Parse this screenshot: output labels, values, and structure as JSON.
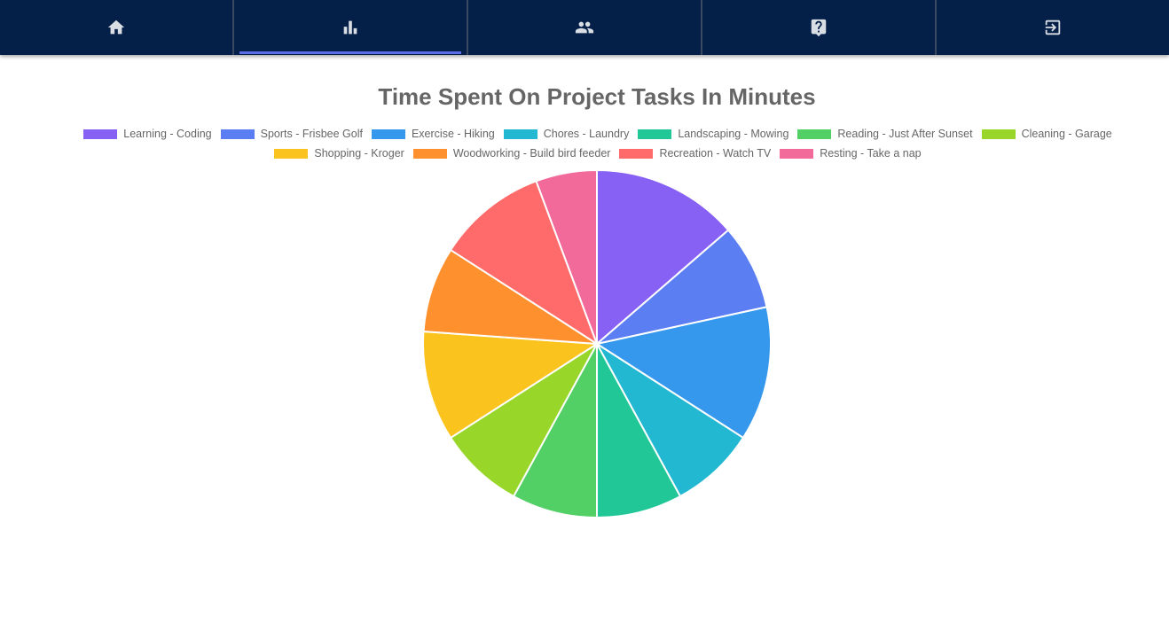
{
  "nav": {
    "items": [
      {
        "icon": "home-icon",
        "active": false
      },
      {
        "icon": "bar-chart-icon",
        "active": true
      },
      {
        "icon": "people-icon",
        "active": false
      },
      {
        "icon": "help-icon",
        "active": false
      },
      {
        "icon": "logout-icon",
        "active": false
      }
    ]
  },
  "chart_data": {
    "type": "pie",
    "title": "Time Spent On Project Tasks In Minutes",
    "legend_position": "top",
    "categories": [
      "Learning - Coding",
      "Sports - Frisbee Golf",
      "Exercise - Hiking",
      "Chores - Laundry",
      "Landscaping - Mowing",
      "Reading - Just After Sunset",
      "Cleaning - Garage",
      "Shopping - Kroger",
      "Woodworking - Build bird feeder",
      "Recreation - Watch TV",
      "Resting - Take a nap"
    ],
    "values": [
      60,
      35,
      55,
      35,
      35,
      35,
      35,
      45,
      35,
      45,
      25
    ],
    "colors": [
      "#8760f4",
      "#5b7ff2",
      "#3598ec",
      "#22b8d2",
      "#21c797",
      "#52cf65",
      "#98d72a",
      "#fbc31e",
      "#ff902e",
      "#ff6b6b",
      "#f16a9a"
    ]
  }
}
